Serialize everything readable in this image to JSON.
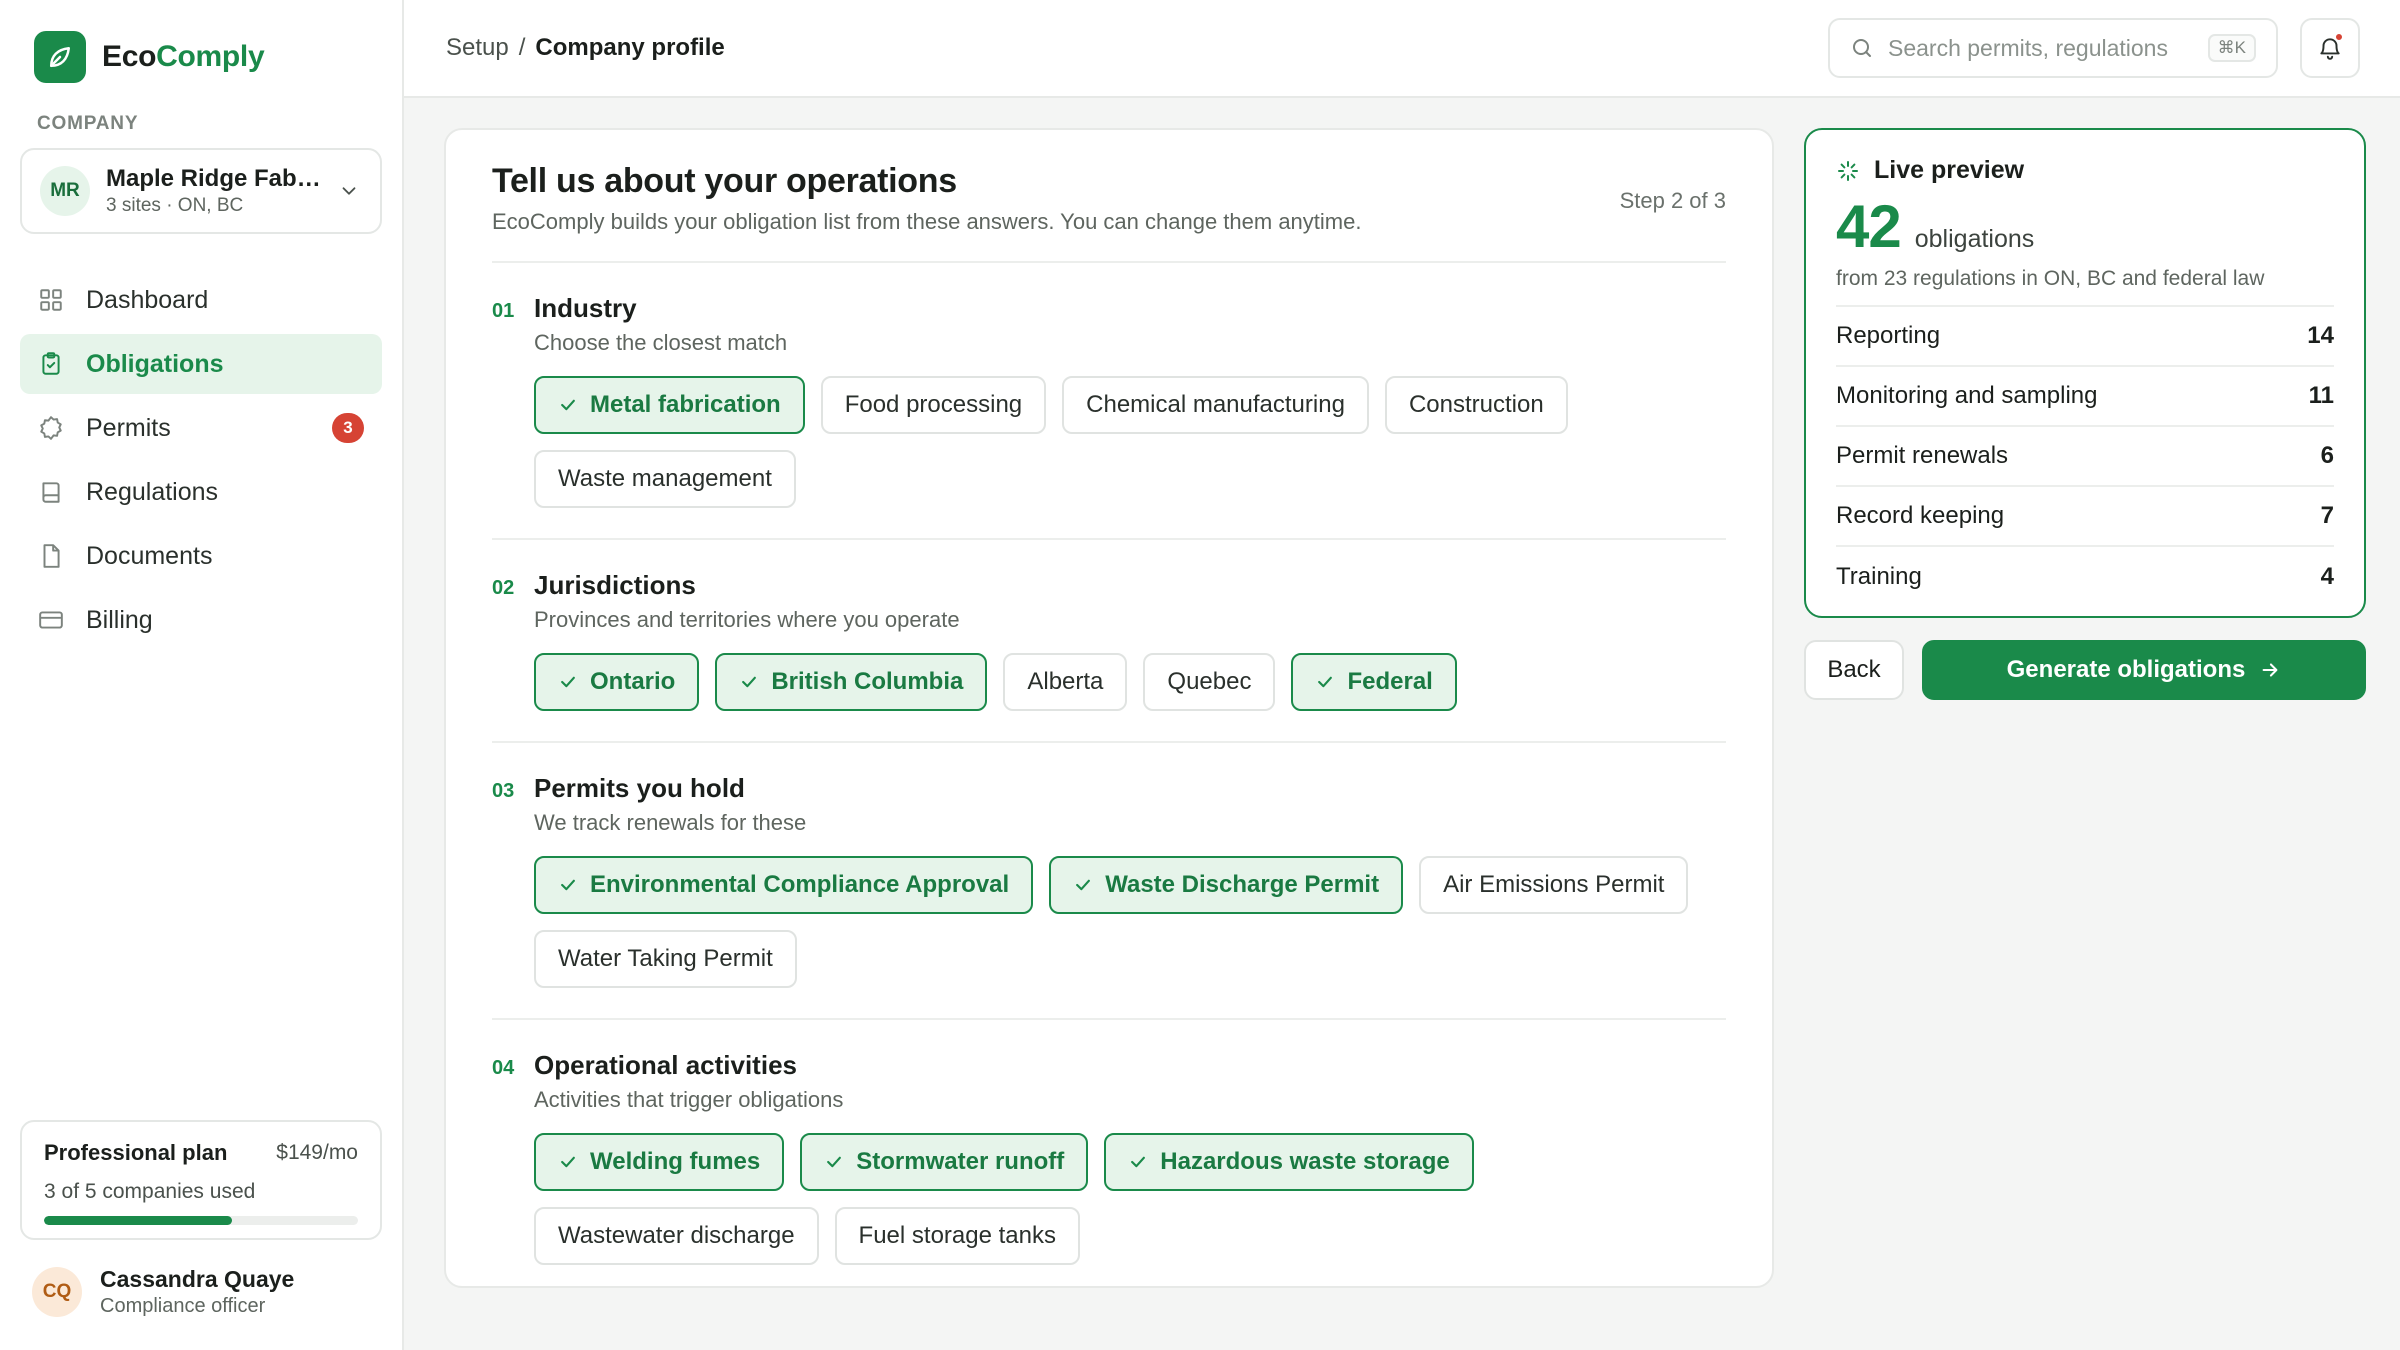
{
  "brand": {
    "name_a": "Eco",
    "name_b": "Comply"
  },
  "company": {
    "section_label": "COMPANY",
    "initials": "MR",
    "name": "Maple Ridge Fabrication",
    "sub": "3 sites · ON, BC"
  },
  "nav": [
    {
      "label": "Dashboard",
      "icon": "grid-icon",
      "active": false
    },
    {
      "label": "Obligations",
      "icon": "clipboard-check-icon",
      "active": true
    },
    {
      "label": "Permits",
      "icon": "badge-icon",
      "active": false,
      "badge": "3"
    },
    {
      "label": "Regulations",
      "icon": "book-icon",
      "active": false
    },
    {
      "label": "Documents",
      "icon": "file-icon",
      "active": false
    },
    {
      "label": "Billing",
      "icon": "credit-card-icon",
      "active": false
    }
  ],
  "plan": {
    "name": "Professional plan",
    "price": "$149/mo",
    "usage": "3 of 5 companies used",
    "progress": 0.6
  },
  "user": {
    "initials": "CQ",
    "name": "Cassandra Quaye",
    "role": "Compliance officer"
  },
  "breadcrumb": {
    "parent": "Setup",
    "sep": "/",
    "current": "Company profile"
  },
  "search": {
    "placeholder": "Search permits, regulations",
    "shortcut": "⌘K"
  },
  "form": {
    "title": "Tell us about your operations",
    "subtitle": "EcoComply builds your obligation list from these answers. You can change them anytime.",
    "step": "Step 2 of 3",
    "questions": [
      {
        "num": "01",
        "title": "Industry",
        "sub": "Choose the closest match",
        "options": [
          {
            "label": "Metal fabrication",
            "selected": true
          },
          {
            "label": "Food processing",
            "selected": false
          },
          {
            "label": "Chemical manufacturing",
            "selected": false
          },
          {
            "label": "Construction",
            "selected": false
          },
          {
            "label": "Waste management",
            "selected": false
          }
        ]
      },
      {
        "num": "02",
        "title": "Jurisdictions",
        "sub": "Provinces and territories where you operate",
        "options": [
          {
            "label": "Ontario",
            "selected": true
          },
          {
            "label": "British Columbia",
            "selected": true
          },
          {
            "label": "Alberta",
            "selected": false
          },
          {
            "label": "Quebec",
            "selected": false
          },
          {
            "label": "Federal",
            "selected": true
          }
        ]
      },
      {
        "num": "03",
        "title": "Permits you hold",
        "sub": "We track renewals for these",
        "options": [
          {
            "label": "Environmental Compliance Approval",
            "selected": true
          },
          {
            "label": "Waste Discharge Permit",
            "selected": true
          },
          {
            "label": "Air Emissions Permit",
            "selected": false
          },
          {
            "label": "Water Taking Permit",
            "selected": false
          }
        ]
      },
      {
        "num": "04",
        "title": "Operational activities",
        "sub": "Activities that trigger obligations",
        "options": [
          {
            "label": "Welding fumes",
            "selected": true
          },
          {
            "label": "Stormwater runoff",
            "selected": true
          },
          {
            "label": "Hazardous waste storage",
            "selected": true
          },
          {
            "label": "Wastewater discharge",
            "selected": false
          },
          {
            "label": "Fuel storage tanks",
            "selected": false
          }
        ]
      }
    ]
  },
  "preview": {
    "title": "Live preview",
    "count": "42",
    "count_label": "obligations",
    "from": "from 23 regulations in ON, BC and federal law",
    "rows": [
      {
        "label": "Reporting",
        "value": "14"
      },
      {
        "label": "Monitoring and sampling",
        "value": "11"
      },
      {
        "label": "Permit renewals",
        "value": "6"
      },
      {
        "label": "Record keeping",
        "value": "7"
      },
      {
        "label": "Training",
        "value": "4"
      }
    ]
  },
  "actions": {
    "back": "Back",
    "generate": "Generate obligations"
  },
  "colors": {
    "accent": "#1a8a4a",
    "accent_soft": "#e6f4ea",
    "badge": "#d64334"
  }
}
